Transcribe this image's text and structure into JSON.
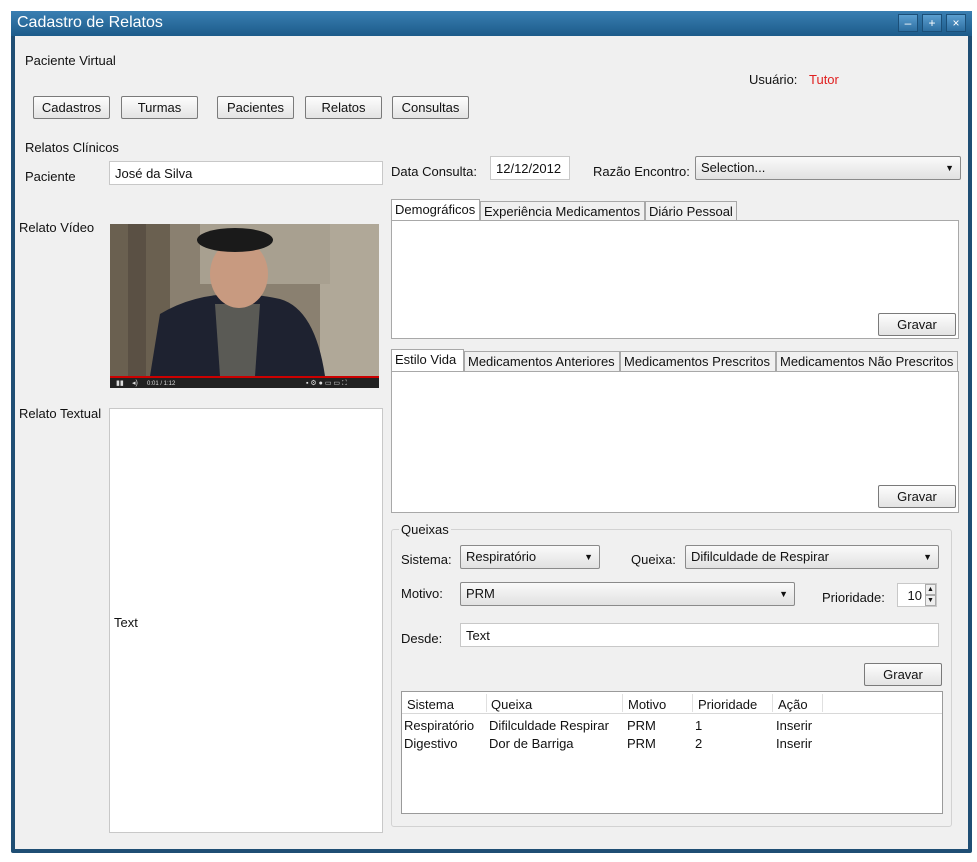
{
  "window": {
    "title": "Cadastro de Relatos"
  },
  "header": {
    "app_name": "Paciente Virtual",
    "user_label": "Usuário:",
    "user_name": "Tutor"
  },
  "nav": {
    "cadastros": "Cadastros",
    "turmas": "Turmas",
    "pacientes": "Pacientes",
    "relatos": "Relatos",
    "consultas": "Consultas"
  },
  "form": {
    "section_title": "Relatos Clínicos",
    "paciente_label": "Paciente",
    "paciente_value": "José da Silva",
    "data_label": "Data Consulta:",
    "data_value": "12/12/2012",
    "razao_label": "Razão Encontro:",
    "razao_value": "Selection...",
    "video_label": "Relato Vídeo",
    "textual_label": "Relato Textual",
    "textual_value": "Text",
    "video_time": "0:01 / 1:12"
  },
  "tabs1": {
    "items": [
      "Demográficos",
      "Experiência Medicamentos",
      "Diário Pessoal"
    ],
    "save": "Gravar"
  },
  "tabs2": {
    "items": [
      "Estilo Vida",
      "Medicamentos Anteriores",
      "Medicamentos Prescritos",
      "Medicamentos Não Prescritos"
    ],
    "save": "Gravar"
  },
  "queixas": {
    "title": "Queixas",
    "sistema_label": "Sistema:",
    "sistema_value": "Respiratório",
    "queixa_label": "Queixa:",
    "queixa_value": "Difilculdade de Respirar",
    "motivo_label": "Motivo:",
    "motivo_value": "PRM",
    "prioridade_label": "Prioridade:",
    "prioridade_value": "10",
    "desde_label": "Desde:",
    "desde_value": "Text",
    "save": "Gravar",
    "columns": [
      "Sistema",
      "Queixa",
      "Motivo",
      "Prioridade",
      "Ação"
    ],
    "rows": [
      [
        "Respiratório",
        "Difilculdade Respirar",
        "PRM",
        "1",
        "Inserir"
      ],
      [
        "Digestivo",
        "Dor de Barriga",
        "PRM",
        "2",
        "Inserir"
      ]
    ]
  },
  "colors": {
    "title_bar": "#1f4e74",
    "user_name": "#e02020",
    "client_bg": "#f0f0f0"
  }
}
